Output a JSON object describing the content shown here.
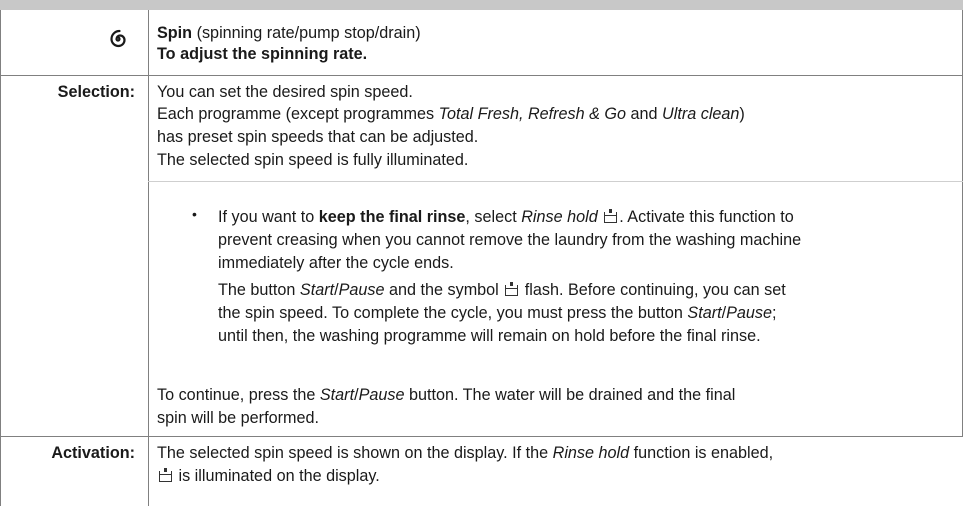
{
  "header": {
    "title_bold": "Spin",
    "title_rest": " (spinning rate/pump stop/drain)",
    "subtitle": "To adjust the spinning rate.",
    "icon": "spin-spiral-icon"
  },
  "selection": {
    "label": "Selection:",
    "line1": "You can set the desired spin speed.",
    "line2_a": "Each programme (except programmes ",
    "line2_b": "Total Fresh, Refresh & Go",
    "line2_c": " and ",
    "line2_d": "Ultra clean",
    "line2_e": ")",
    "line3": "has preset spin speeds that can be adjusted.",
    "line4": "The selected spin speed is fully illuminated.",
    "bullet_glyph": "•",
    "b1_a": "If you want to ",
    "b1_b": "keep the final rinse",
    "b1_c": ", select ",
    "b1_d": "Rinse hold",
    "b1_e": ". Activate this function to",
    "b2": "prevent creasing when you cannot remove the laundry from the washing machine",
    "b3": "immediately after the cycle ends.",
    "b4_a": "The button ",
    "b4_b": "Start",
    "b4_c": "/",
    "b4_d": "Pause",
    "b4_e": " and the symbol ",
    "b4_f": " flash. Before continuing, you can set",
    "b5_a": "the spin speed. To complete the cycle, you must press the button ",
    "b5_b": "Start",
    "b5_c": "/",
    "b5_d": "Pause",
    "b5_e": ";",
    "b6": "until then, the washing programme will remain on hold before the final rinse.",
    "c1_a": "To continue, press the ",
    "c1_b": "Start",
    "c1_c": "/",
    "c1_d": "Pause",
    "c1_e": " button. The water will be drained and the final",
    "c2": "spin will be performed."
  },
  "activation": {
    "label": "Activation:",
    "a1_a": "The selected spin speed is shown on the display. If the ",
    "a1_b": "Rinse hold",
    "a1_c": " function is enabled,",
    "a2": " is illuminated on the display."
  }
}
